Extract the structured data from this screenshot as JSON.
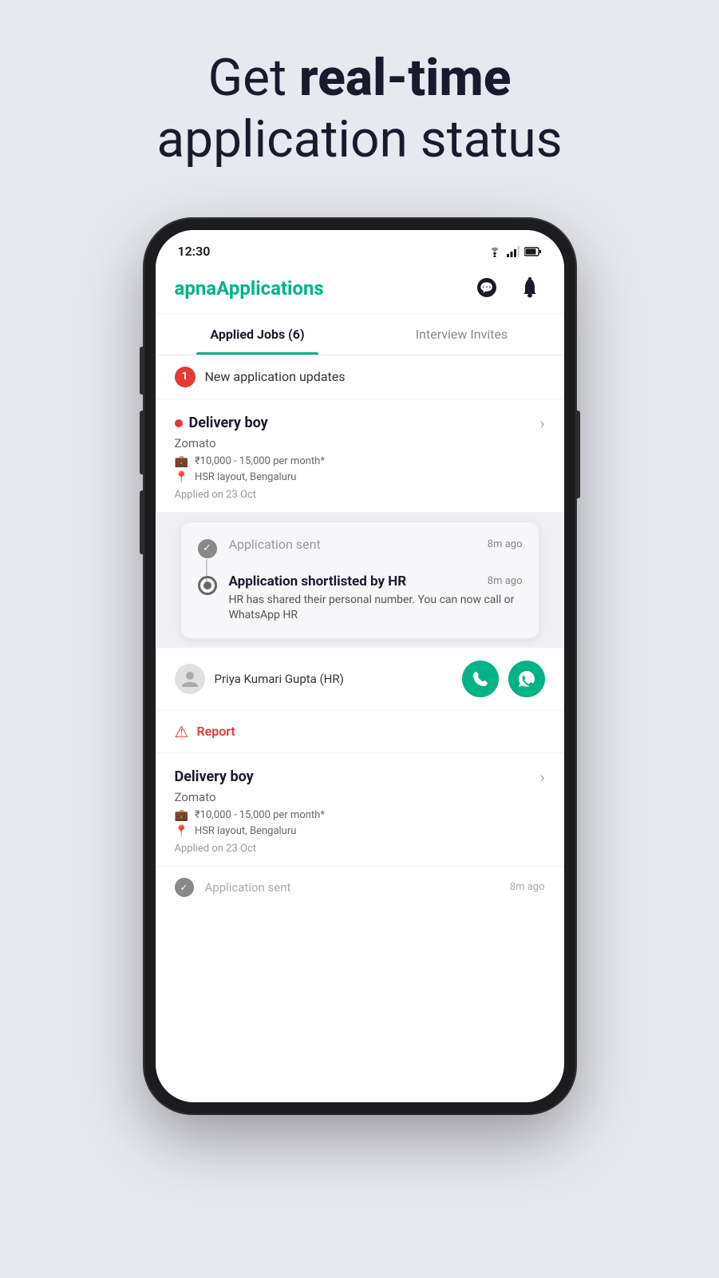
{
  "hero": {
    "line1": "Get ",
    "highlight": "real-time",
    "line2": "application status"
  },
  "status_bar": {
    "time": "12:30",
    "wifi": "▼",
    "signal": "▲",
    "battery": "🔋"
  },
  "app_header": {
    "logo_regular": "apna",
    "logo_accent": "Applications",
    "chat_icon": "chat",
    "bell_icon": "bell"
  },
  "tabs": [
    {
      "label": "Applied Jobs (6)",
      "active": true
    },
    {
      "label": "Interview Invites",
      "active": false
    }
  ],
  "notification": {
    "badge": "1",
    "text": "New application updates"
  },
  "job1": {
    "title": "Delivery boy",
    "company": "Zomato",
    "salary": "₹10,000 - 15,000 per month*",
    "location": "HSR layout, Bengaluru",
    "applied_date": "Applied on 23 Oct"
  },
  "status_timeline": {
    "item1": {
      "title": "Application sent",
      "time": "8m ago",
      "bold": false
    },
    "item2": {
      "title": "Application shortlisted by HR",
      "time": "8m ago",
      "desc": "HR has shared their personal number. You can now call or WhatsApp HR",
      "bold": true
    }
  },
  "hr_contact": {
    "name": "Priya Kumari Gupta (HR)",
    "call_icon": "📞",
    "whatsapp_icon": "💬"
  },
  "report": {
    "text": "Report"
  },
  "job2": {
    "title": "Delivery boy",
    "company": "Zomato",
    "salary": "₹10,000 - 15,000 per month*",
    "location": "HSR layout, Bengaluru",
    "applied_date": "Applied on 23 Oct"
  },
  "bottom_status": {
    "title": "Application sent",
    "time": "8m ago"
  },
  "colors": {
    "accent_green": "#00b386",
    "dark_navy": "#1a1a2e",
    "red": "#e53935"
  }
}
